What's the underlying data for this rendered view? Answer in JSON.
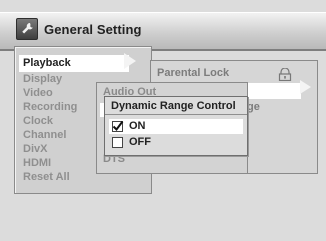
{
  "header": {
    "title": "General Setting",
    "icon": "wrench-icon"
  },
  "menu": {
    "items": [
      {
        "label": "Playback",
        "selected": true
      },
      {
        "label": "Display",
        "selected": false
      },
      {
        "label": "Video",
        "selected": false
      },
      {
        "label": "Recording",
        "selected": false
      },
      {
        "label": "Clock",
        "selected": false
      },
      {
        "label": "Channel",
        "selected": false
      },
      {
        "label": "DivX",
        "selected": false
      },
      {
        "label": "HDMI",
        "selected": false
      },
      {
        "label": "Reset All",
        "selected": false
      }
    ]
  },
  "submenu": {
    "items": [
      {
        "label": "Parental Lock"
      },
      {
        "label": "ge"
      }
    ],
    "lock_icon": "lock-icon"
  },
  "audio_menu": {
    "title": "Audio Out",
    "items": [
      {
        "label": "DTS"
      }
    ]
  },
  "drc_dialog": {
    "title": "Dynamic Range Control",
    "options": [
      {
        "label": "ON",
        "checked": true,
        "selected": true
      },
      {
        "label": "OFF",
        "checked": false,
        "selected": false
      }
    ]
  }
}
